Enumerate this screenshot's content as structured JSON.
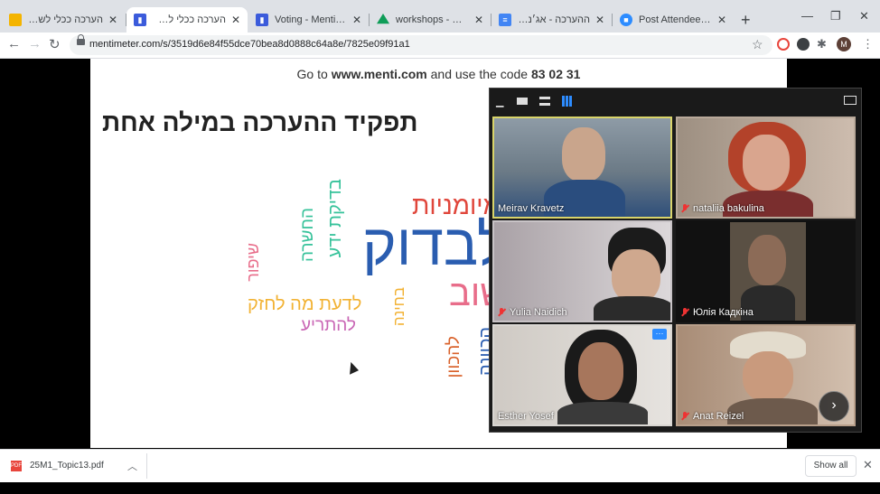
{
  "browser": {
    "tabs": [
      {
        "title": "הערכה ככלי לשיפור לה",
        "favicon_color": "#f4b400"
      },
      {
        "title": "הערכה ככלי לשיפור לה",
        "favicon_color": "#3b5bdb",
        "active": true
      },
      {
        "title": "Voting - Mentimeter",
        "favicon_color": "#3b5bdb"
      },
      {
        "title": "workshops - Google Dr",
        "favicon_color": "#0f9d58"
      },
      {
        "title": "ההערכה - אג׳נדה לסדי",
        "favicon_color": "#4285f4"
      },
      {
        "title": "Post Attendee - Zoom",
        "favicon_color": "#2d8cff"
      }
    ],
    "url": "mentimeter.com/s/3519d6e84f55dce70bea8d0888c64a8e/7825e09f91a1",
    "profile_initial": "M"
  },
  "presentation": {
    "instruction_prefix": "Go to ",
    "instruction_site": "www.menti.com",
    "instruction_mid": " and use the code ",
    "instruction_code": "83 02 31",
    "title": "תפקיד ההערכה במילה אחת"
  },
  "wordcloud": [
    {
      "text": "לבדוק",
      "color": "#2a5db0"
    },
    {
      "text": "מיומניות",
      "color": "#e0463b"
    },
    {
      "text": "לשוב",
      "color": "#e86d8a"
    },
    {
      "text": "לדעת מה לחזק",
      "color": "#f2b233"
    },
    {
      "text": "להתריע",
      "color": "#c966b5"
    },
    {
      "text": "שיפור",
      "color": "#e86d8a"
    },
    {
      "text": "החשרה",
      "color": "#36c29a"
    },
    {
      "text": "בדיקת ידע",
      "color": "#36c29a"
    },
    {
      "text": "בחינה",
      "color": "#f2b233"
    },
    {
      "text": "להכוון",
      "color": "#d9622b"
    },
    {
      "text": "הכוונה",
      "color": "#2a5db0"
    }
  ],
  "zoom": {
    "participants": [
      {
        "name": "Meirav Kravetz",
        "muted": false,
        "active": true
      },
      {
        "name": "nataliia bakulina",
        "muted": true
      },
      {
        "name": "Yulia Naidich",
        "muted": true
      },
      {
        "name": "Юлія Кадкіна",
        "muted": true
      },
      {
        "name": "Esther Yosef",
        "muted": false
      },
      {
        "name": "Anat Reizel",
        "muted": true
      }
    ],
    "more_label": "···"
  },
  "downloads": {
    "file_name": "25M1_Topic13.pdf",
    "file_type_label": "PDF",
    "show_all_label": "Show all"
  }
}
